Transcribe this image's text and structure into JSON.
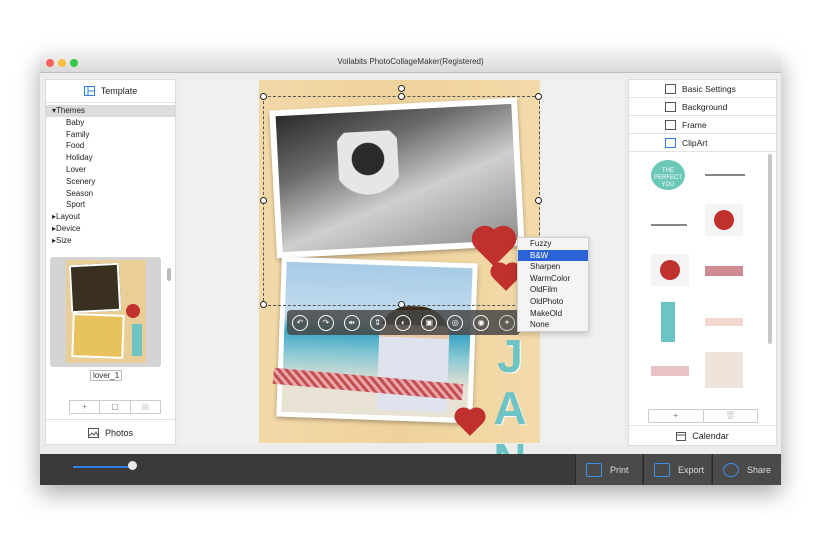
{
  "window": {
    "title": "Voilabits PhotoCollageMaker(Registered)"
  },
  "left_panel": {
    "template_label": "Template",
    "tree": {
      "themes_label": "Themes",
      "themes": [
        "Baby",
        "Family",
        "Food",
        "Holiday",
        "Lover",
        "Scenery",
        "Season",
        "Sport"
      ],
      "layout_label": "Layout",
      "device_label": "Device",
      "size_label": "Size"
    },
    "selected_template": "lover_1",
    "tools": [
      "+",
      "▢",
      "▤"
    ],
    "photos_label": "Photos"
  },
  "canvas": {
    "letters": "JAN",
    "context_menu": {
      "items": [
        "Fuzzy",
        "B&W",
        "Sharpen",
        "WarmColor",
        "OldFilm",
        "OldPhoto",
        "MakeOld",
        "None"
      ],
      "selected": "B&W"
    },
    "toolbar_icons": [
      "undo-icon",
      "redo-icon",
      "flip-horizontal-icon",
      "flip-vertical-icon",
      "crop-icon",
      "lock-icon",
      "adjust-icon",
      "border-icon",
      "effects-icon"
    ]
  },
  "right_panel": {
    "items": [
      {
        "label": "Basic Settings",
        "icon": "basic-settings-icon"
      },
      {
        "label": "Background",
        "icon": "background-icon"
      },
      {
        "label": "Frame",
        "icon": "frame-icon"
      },
      {
        "label": "ClipArt",
        "icon": "clipart-icon"
      }
    ],
    "clipart_badge": "THE PERFECT YOU",
    "tools": [
      "+",
      "🗑"
    ],
    "calendar_label": "Calendar"
  },
  "bottom_bar": {
    "zoom": 0.9,
    "print_label": "Print",
    "export_label": "Export",
    "share_label": "Share"
  },
  "colors": {
    "accent": "#2c63d6",
    "slider": "#2f7fe0",
    "bar": "#3a3a3a"
  }
}
